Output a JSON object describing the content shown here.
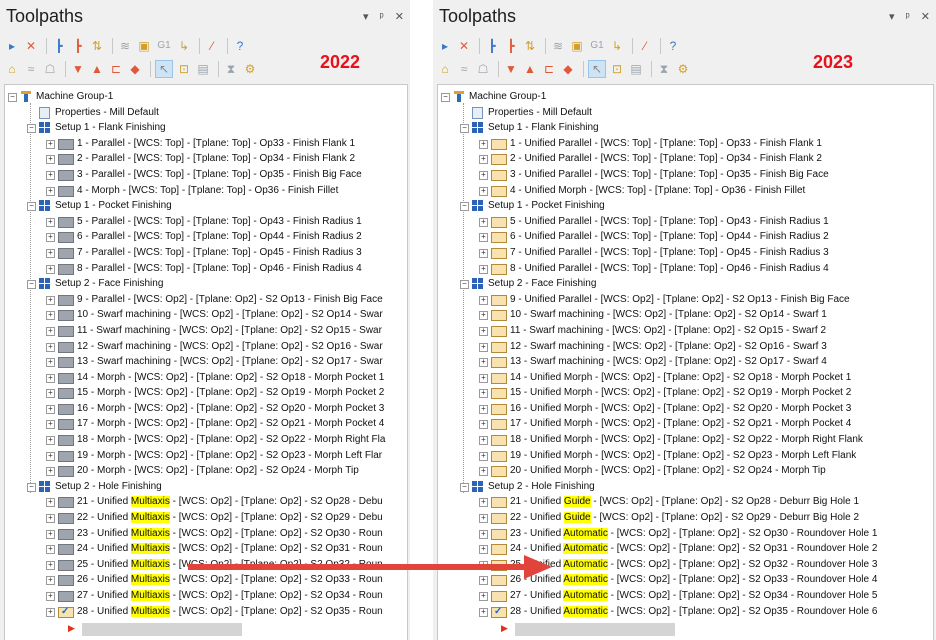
{
  "title": "Toolpaths",
  "title_buttons": {
    "dropdown": "▾",
    "pin": "ᵖ",
    "close": "✕"
  },
  "toolbar_g1": "G1",
  "years": {
    "left": "2022",
    "right": "2023"
  },
  "colors": {
    "year_red": "#e8101a",
    "highlight": "#ffff00",
    "arrow": "#e0443a"
  },
  "tree_2022": [
    {
      "level": 0,
      "icon": "machine-group",
      "label": "Machine Group-1"
    },
    {
      "level": 1,
      "icon": "properties",
      "label": "Properties - Mill Default"
    },
    {
      "level": 1,
      "icon": "setup",
      "label": "Setup 1 - Flank Finishing"
    },
    {
      "level": 2,
      "icon": "folder-grey",
      "label": "1 - Parallel - [WCS: Top] - [Tplane: Top] - Op33 - Finish Flank 1"
    },
    {
      "level": 2,
      "icon": "folder-grey",
      "label": "2 - Parallel - [WCS: Top] - [Tplane: Top] - Op34 - Finish Flank 2"
    },
    {
      "level": 2,
      "icon": "folder-grey",
      "label": "3 - Parallel - [WCS: Top] - [Tplane: Top] - Op35 - Finish Big Face"
    },
    {
      "level": 2,
      "icon": "folder-grey",
      "label": "4 - Morph - [WCS: Top] - [Tplane: Top] - Op36 - Finish Fillet"
    },
    {
      "level": 1,
      "icon": "setup",
      "label": "Setup 1 - Pocket Finishing"
    },
    {
      "level": 2,
      "icon": "folder-grey",
      "label": "5 - Parallel - [WCS: Top] - [Tplane: Top] - Op43 - Finish Radius 1"
    },
    {
      "level": 2,
      "icon": "folder-grey",
      "label": "6 - Parallel - [WCS: Top] - [Tplane: Top] - Op44 - Finish Radius 2"
    },
    {
      "level": 2,
      "icon": "folder-grey",
      "label": "7 - Parallel - [WCS: Top] - [Tplane: Top] - Op45 - Finish Radius 3"
    },
    {
      "level": 2,
      "icon": "folder-grey",
      "label": "8 - Parallel - [WCS: Top] - [Tplane: Top] - Op46 - Finish Radius 4"
    },
    {
      "level": 1,
      "icon": "setup",
      "label": "Setup 2 - Face Finishing"
    },
    {
      "level": 2,
      "icon": "folder-grey",
      "label": "9 - Parallel - [WCS: Op2] - [Tplane: Op2] - S2 Op13 - Finish Big Face"
    },
    {
      "level": 2,
      "icon": "folder-grey",
      "label": "10 - Swarf machining - [WCS: Op2] - [Tplane: Op2] - S2 Op14 - Swar"
    },
    {
      "level": 2,
      "icon": "folder-grey",
      "label": "11 - Swarf machining - [WCS: Op2] - [Tplane: Op2] - S2 Op15 - Swar"
    },
    {
      "level": 2,
      "icon": "folder-grey",
      "label": "12 - Swarf machining - [WCS: Op2] - [Tplane: Op2] - S2 Op16 - Swar"
    },
    {
      "level": 2,
      "icon": "folder-grey",
      "label": "13 - Swarf machining - [WCS: Op2] - [Tplane: Op2] - S2 Op17 - Swar"
    },
    {
      "level": 2,
      "icon": "folder-grey",
      "label": "14 - Morph - [WCS: Op2] - [Tplane: Op2] - S2 Op18 - Morph Pocket 1"
    },
    {
      "level": 2,
      "icon": "folder-grey",
      "label": "15 - Morph - [WCS: Op2] - [Tplane: Op2] - S2 Op19 - Morph Pocket 2"
    },
    {
      "level": 2,
      "icon": "folder-grey",
      "label": "16 - Morph - [WCS: Op2] - [Tplane: Op2] - S2 Op20 - Morph Pocket 3"
    },
    {
      "level": 2,
      "icon": "folder-grey",
      "label": "17 - Morph - [WCS: Op2] - [Tplane: Op2] - S2 Op21 - Morph Pocket 4"
    },
    {
      "level": 2,
      "icon": "folder-grey",
      "label": "18 - Morph - [WCS: Op2] - [Tplane: Op2] - S2 Op22 - Morph Right Fla"
    },
    {
      "level": 2,
      "icon": "folder-grey",
      "label": "19 - Morph - [WCS: Op2] - [Tplane: Op2] - S2 Op23 - Morph Left Flar"
    },
    {
      "level": 2,
      "icon": "folder-grey",
      "label": "20 - Morph - [WCS: Op2] - [Tplane: Op2] - S2 Op24 - Morph Tip"
    },
    {
      "level": 1,
      "icon": "setup",
      "label": "Setup 2 - Hole Finishing"
    },
    {
      "level": 2,
      "icon": "folder-grey",
      "pre": "21 - Unified ",
      "hl": "Multiaxis",
      "post": " - [WCS: Op2] - [Tplane: Op2] - S2 Op28 - Debu"
    },
    {
      "level": 2,
      "icon": "folder-grey",
      "pre": "22 - Unified ",
      "hl": "Multiaxis",
      "post": " - [WCS: Op2] - [Tplane: Op2] - S2 Op29 - Debu"
    },
    {
      "level": 2,
      "icon": "folder-grey",
      "pre": "23 - Unified ",
      "hl": "Multiaxis",
      "post": " - [WCS: Op2] - [Tplane: Op2] - S2 Op30 - Roun"
    },
    {
      "level": 2,
      "icon": "folder-grey",
      "pre": "24 - Unified ",
      "hl": "Multiaxis",
      "post": " - [WCS: Op2] - [Tplane: Op2] - S2 Op31 - Roun"
    },
    {
      "level": 2,
      "icon": "folder-grey",
      "pre": "25 - Unified ",
      "hl": "Multiaxis",
      "post": " - [WCS: Op2] - [Tplane: Op2] - S2 Op32 - Roun"
    },
    {
      "level": 2,
      "icon": "folder-grey",
      "pre": "26 - Unified ",
      "hl": "Multiaxis",
      "post": " - [WCS: Op2] - [Tplane: Op2] - S2 Op33 - Roun"
    },
    {
      "level": 2,
      "icon": "folder-grey",
      "pre": "27 - Unified ",
      "hl": "Multiaxis",
      "post": " - [WCS: Op2] - [Tplane: Op2] - S2 Op34 - Roun"
    },
    {
      "level": 2,
      "icon": "folder-check",
      "pre": "28 - Unified ",
      "hl": "Multiaxis",
      "post": " - [WCS: Op2] - [Tplane: Op2] - S2 Op35 - Roun"
    }
  ],
  "tree_2023": [
    {
      "level": 0,
      "icon": "machine-group",
      "label": "Machine Group-1"
    },
    {
      "level": 1,
      "icon": "properties",
      "label": "Properties - Mill Default"
    },
    {
      "level": 1,
      "icon": "setup",
      "label": "Setup 1 - Flank Finishing"
    },
    {
      "level": 2,
      "icon": "folder-tan",
      "label": "1 - Unified Parallel - [WCS: Top] - [Tplane: Top] - Op33 - Finish Flank 1"
    },
    {
      "level": 2,
      "icon": "folder-tan",
      "label": "2 - Unified Parallel - [WCS: Top] - [Tplane: Top] - Op34 - Finish Flank 2"
    },
    {
      "level": 2,
      "icon": "folder-tan",
      "label": "3 - Unified Parallel - [WCS: Top] - [Tplane: Top] - Op35 - Finish Big Face"
    },
    {
      "level": 2,
      "icon": "folder-tan",
      "label": "4 - Unified Morph - [WCS: Top] - [Tplane: Top] - Op36 - Finish Fillet"
    },
    {
      "level": 1,
      "icon": "setup",
      "label": "Setup 1 - Pocket Finishing"
    },
    {
      "level": 2,
      "icon": "folder-tan",
      "label": "5 - Unified Parallel - [WCS: Top] - [Tplane: Top] - Op43 - Finish Radius 1"
    },
    {
      "level": 2,
      "icon": "folder-tan",
      "label": "6 - Unified Parallel - [WCS: Top] - [Tplane: Top] - Op44 - Finish Radius 2"
    },
    {
      "level": 2,
      "icon": "folder-tan",
      "label": "7 - Unified Parallel - [WCS: Top] - [Tplane: Top] - Op45 - Finish Radius 3"
    },
    {
      "level": 2,
      "icon": "folder-tan",
      "label": "8 - Unified Parallel - [WCS: Top] - [Tplane: Top] - Op46 - Finish Radius 4"
    },
    {
      "level": 1,
      "icon": "setup",
      "label": "Setup 2 - Face Finishing"
    },
    {
      "level": 2,
      "icon": "folder-tan",
      "label": "9 - Unified Parallel - [WCS: Op2] - [Tplane: Op2] - S2 Op13 - Finish Big Face"
    },
    {
      "level": 2,
      "icon": "folder-tan",
      "label": "10 - Swarf machining - [WCS: Op2] - [Tplane: Op2] - S2 Op14 - Swarf 1"
    },
    {
      "level": 2,
      "icon": "folder-tan",
      "label": "11 - Swarf machining - [WCS: Op2] - [Tplane: Op2] - S2 Op15 - Swarf 2"
    },
    {
      "level": 2,
      "icon": "folder-tan",
      "label": "12 - Swarf machining - [WCS: Op2] - [Tplane: Op2] - S2 Op16 - Swarf 3"
    },
    {
      "level": 2,
      "icon": "folder-tan",
      "label": "13 - Swarf machining - [WCS: Op2] - [Tplane: Op2] - S2 Op17 - Swarf 4"
    },
    {
      "level": 2,
      "icon": "folder-tan",
      "label": "14 - Unified Morph - [WCS: Op2] - [Tplane: Op2] - S2 Op18 - Morph Pocket 1"
    },
    {
      "level": 2,
      "icon": "folder-tan",
      "label": "15 - Unified Morph - [WCS: Op2] - [Tplane: Op2] - S2 Op19 - Morph Pocket 2"
    },
    {
      "level": 2,
      "icon": "folder-tan",
      "label": "16 - Unified Morph - [WCS: Op2] - [Tplane: Op2] - S2 Op20 - Morph Pocket 3"
    },
    {
      "level": 2,
      "icon": "folder-tan",
      "label": "17 - Unified Morph - [WCS: Op2] - [Tplane: Op2] - S2 Op21 - Morph Pocket 4"
    },
    {
      "level": 2,
      "icon": "folder-tan",
      "label": "18 - Unified Morph - [WCS: Op2] - [Tplane: Op2] - S2 Op22 - Morph Right Flank"
    },
    {
      "level": 2,
      "icon": "folder-tan",
      "label": "19 - Unified Morph - [WCS: Op2] - [Tplane: Op2] - S2 Op23 - Morph Left Flank"
    },
    {
      "level": 2,
      "icon": "folder-tan",
      "label": "20 - Unified Morph - [WCS: Op2] - [Tplane: Op2] - S2 Op24 - Morph Tip"
    },
    {
      "level": 1,
      "icon": "setup",
      "label": "Setup 2 - Hole Finishing"
    },
    {
      "level": 2,
      "icon": "folder-tan",
      "pre": "21 - Unified ",
      "hl": "Guide",
      "post": " - [WCS: Op2] - [Tplane: Op2] - S2 Op28 - Deburr Big Hole 1"
    },
    {
      "level": 2,
      "icon": "folder-tan",
      "pre": "22 - Unified ",
      "hl": "Guide",
      "post": " - [WCS: Op2] - [Tplane: Op2] - S2 Op29 - Deburr Big Hole 2"
    },
    {
      "level": 2,
      "icon": "folder-tan",
      "pre": "23 - Unified ",
      "hl": "Automatic",
      "post": " - [WCS: Op2] - [Tplane: Op2] - S2 Op30 - Roundover Hole 1"
    },
    {
      "level": 2,
      "icon": "folder-tan",
      "pre": "24 - Unified ",
      "hl": "Automatic",
      "post": " - [WCS: Op2] - [Tplane: Op2] - S2 Op31 - Roundover Hole 2"
    },
    {
      "level": 2,
      "icon": "folder-tan",
      "pre": "25 - Unified ",
      "hl": "Automatic",
      "post": " - [WCS: Op2] - [Tplane: Op2] - S2 Op32 - Roundover Hole 3"
    },
    {
      "level": 2,
      "icon": "folder-tan",
      "pre": "26 - Unified ",
      "hl": "Automatic",
      "post": " - [WCS: Op2] - [Tplane: Op2] - S2 Op33 - Roundover Hole 4"
    },
    {
      "level": 2,
      "icon": "folder-tan",
      "pre": "27 - Unified ",
      "hl": "Automatic",
      "post": " - [WCS: Op2] - [Tplane: Op2] - S2 Op34 - Roundover Hole 5"
    },
    {
      "level": 2,
      "icon": "folder-check",
      "pre": "28 - Unified ",
      "hl": "Automatic",
      "post": " - [WCS: Op2] - [Tplane: Op2] - S2 Op35 - Roundover Hole 6"
    }
  ]
}
